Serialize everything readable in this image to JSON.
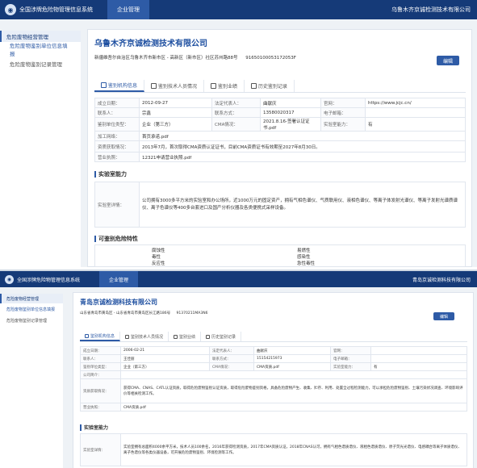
{
  "s1": {
    "system_title": "全国涉牌危险物管理信息系统",
    "nav_tab": "企业管理",
    "top_company": "乌鲁木齐京诚检测技术有限公司",
    "side_group": "危险废物经营管理",
    "side_items": [
      "危险废物鉴别单位信息填报",
      "危险废物鉴别记录管理"
    ],
    "company_name": "乌鲁木齐京诚检测技术有限公司",
    "address": "新疆维吾尔自治区乌鲁木齐市新市区 - 高新区（新市区）社区苏州路88号",
    "credit_code": "91650100053172053F",
    "edit_label": "编辑",
    "tabs": [
      "鉴别机构信息",
      "鉴别技术人员情况",
      "鉴别业绩",
      "历史鉴别记录"
    ],
    "rows": [
      [
        "成立日期：",
        "2012-09-27",
        "法定代表人：",
        "曲献庆",
        "官网：",
        "https://www.jcjc.cn/"
      ],
      [
        "联系人：",
        "宗鑫",
        "联系方式：",
        "13580020317",
        "电子邮箱：",
        ""
      ],
      [
        "鉴别单位类型：",
        "企业（第三方）",
        "CMA情况：",
        "2021.8.16-签署认证证书.pdf",
        "实验室能力：",
        "有"
      ],
      [
        "加工网络：",
        "首页承诺.pdf"
      ],
      [
        "资质获取情况：",
        "2013年7月，首次取得CMA资质认证证书，目前CMA资质证书有效期至2027年8月30日。"
      ],
      [
        "营业执照：",
        "12321申请营业执照.pdf"
      ]
    ],
    "section_capability": "实验室能力",
    "capability_label": "实验室详情：",
    "capability_text": "公司拥有3000多平方米的实验室和办公场所，近1000万元的固定资产，拥有气相色谱仪、气质联用仪、液相色谱仪、等离子体发射光谱仪、等离子发射光谱质谱仪、离子色谱仪等400多台套进口及国产分析仪器及各类便携式采样设备。",
    "section_hazard": "可鉴别危险特性",
    "hazard_items": [
      "腐蚀性",
      "毒性",
      "反应性",
      "易燃性",
      "感染性",
      "急性毒性"
    ]
  },
  "s2": {
    "system_title": "全国涉牌危险物管理信息系统",
    "nav_tab": "企业管理",
    "top_company": "青岛京诚检测科技有限公司",
    "side_group": "危险废物经营管理",
    "side_items": [
      "危险废物鉴别单位信息填报",
      "危险废物鉴别记录管理"
    ],
    "company_name": "青岛京诚检测科技有限公司",
    "address": "山东省青岛市黄岛区 - 山东省青岛市黄岛区长江路186号",
    "credit_code": "91370211MA3N6",
    "edit_label": "编辑",
    "tabs": [
      "鉴别机构信息",
      "鉴别技术人员情况",
      "鉴别业绩",
      "历史鉴别记录"
    ],
    "rows": [
      [
        "成立日期：",
        "2006-02-21",
        "法定代表人：",
        "曲献庆",
        "官网：",
        ""
      ],
      [
        "联系人：",
        "王佳丽",
        "联系方式：",
        "15154215973",
        "电子邮箱：",
        ""
      ],
      [
        "鉴别单位类型：",
        "企业（第三方）",
        "CMA情况：",
        "CMA资质.pdf",
        "实验室能力：",
        "有"
      ],
      [
        "公司简介：",
        ""
      ],
      [
        "资质获取情况：",
        "获得CMA、CNAS、CATL认证资质，取得危险废物鉴别认证资质，取得危险废物鉴别资格，具备危险废物产生、收集、贮存、利用、处置全过程检测能力，可以承担危险废物鉴别、土壤污染状况调查、环境影响评价等相关检测工作。"
      ],
      [
        "营业执照：",
        "CMA资质.pdf"
      ]
    ],
    "section_capability": "实验室能力",
    "capability_label": "实验室详情：",
    "capability_text": "实验室拥有总面积4000余平方米，技术人员100余名，2016年获得检测资质，2017年CMA资质认证，2018年CNAS认可，拥有气相色谱质谱仪、液相色谱质谱仪、原子荧光光谱仪、电感耦合等离子体质谱仪、离子色谱仪等各类仪器设备，可开展危险废物鉴别、环境检测等工作。"
  }
}
